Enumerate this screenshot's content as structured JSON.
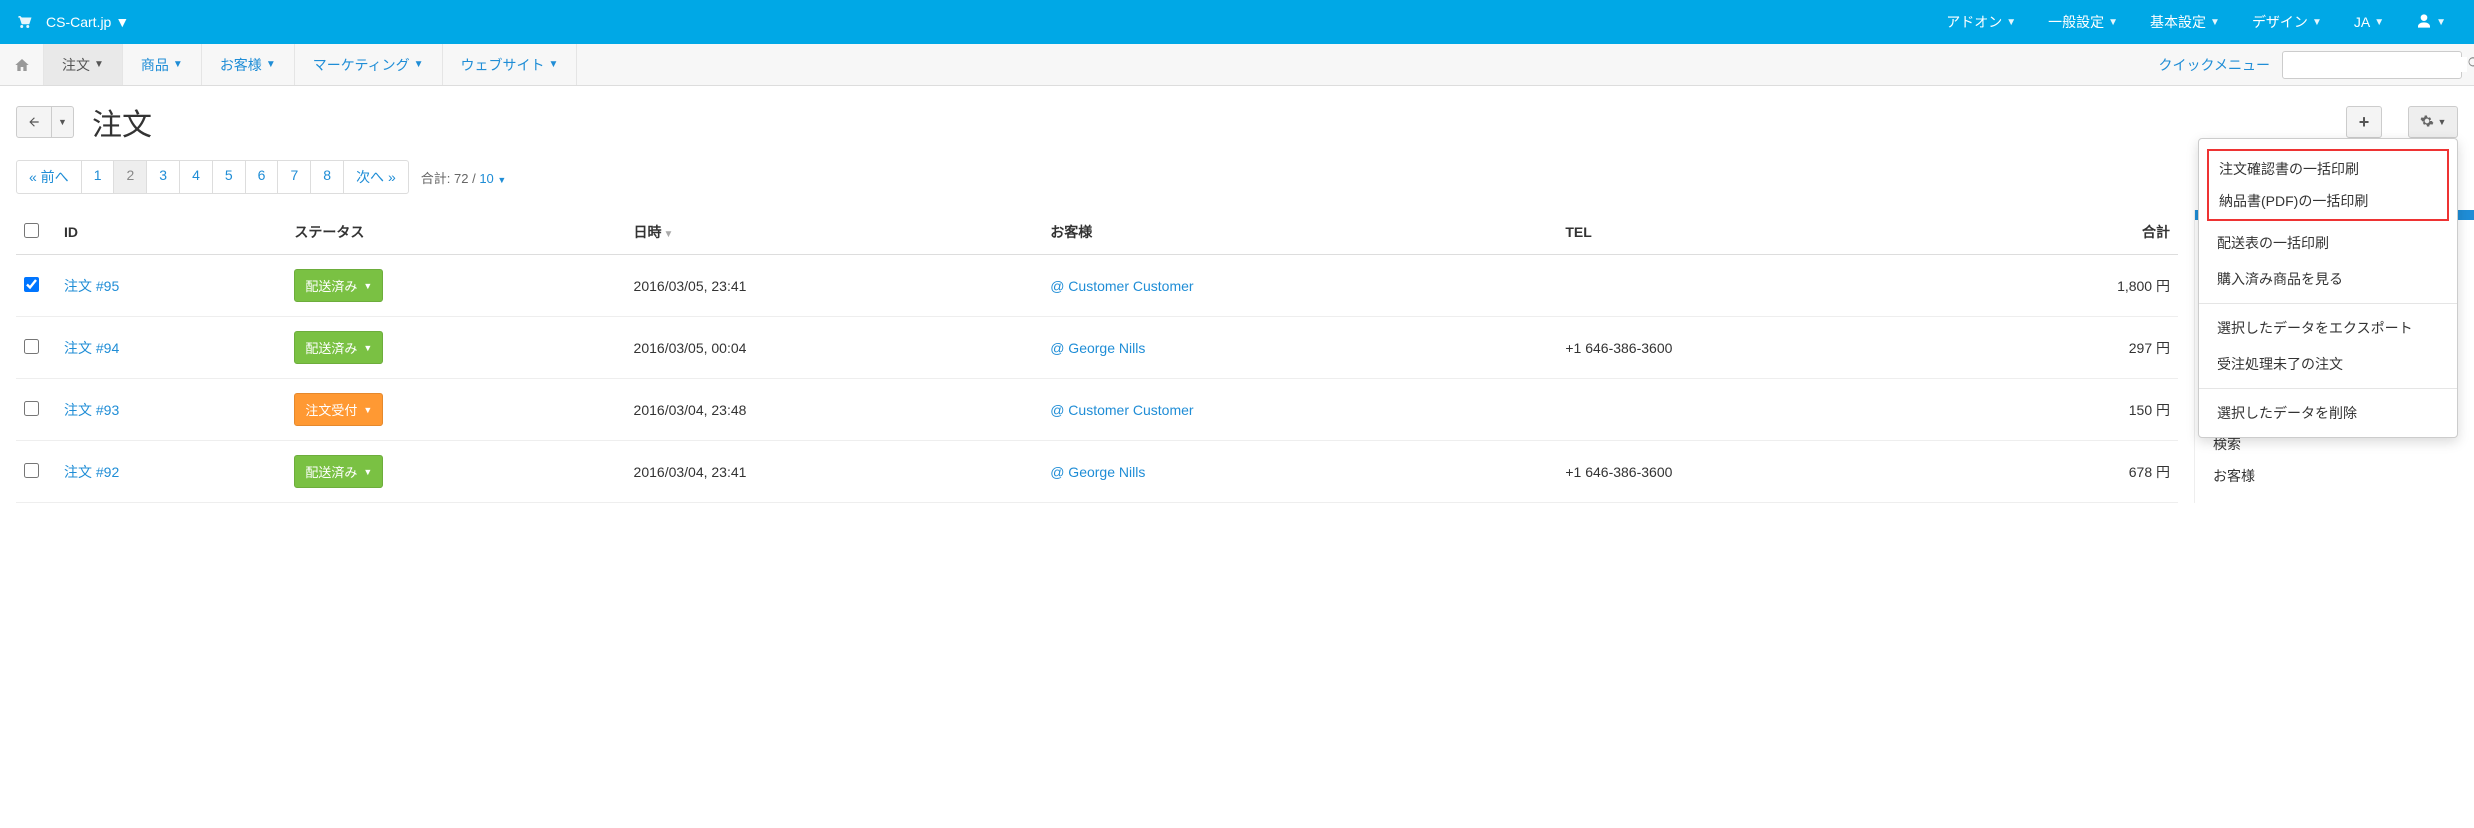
{
  "topbar": {
    "brand": "CS-Cart.jp",
    "menu": [
      "アドオン",
      "一般設定",
      "基本設定",
      "デザイン",
      "JA"
    ]
  },
  "navbar": {
    "items": [
      {
        "label": "注文",
        "active": true
      },
      {
        "label": "商品",
        "active": false
      },
      {
        "label": "お客様",
        "active": false
      },
      {
        "label": "マーケティング",
        "active": false
      },
      {
        "label": "ウェブサイト",
        "active": false
      }
    ],
    "quick": "クイックメニュー",
    "search_placeholder": ""
  },
  "page": {
    "title": "注文"
  },
  "pagination": {
    "prev": "« 前へ",
    "pages": [
      "1",
      "2",
      "3",
      "4",
      "5",
      "6",
      "7",
      "8"
    ],
    "active": "2",
    "next": "次へ »",
    "total_label": "合計:",
    "total_count": "72",
    "per_page": "10"
  },
  "columns": {
    "id": "ID",
    "status": "ステータス",
    "datetime": "日時",
    "customer": "お客様",
    "tel": "TEL",
    "total": "合計"
  },
  "rows": [
    {
      "checked": true,
      "id": "注文 #95",
      "status": "配送済み",
      "status_color": "green",
      "datetime": "2016/03/05, 23:41",
      "customer": "Customer Customer",
      "tel": "",
      "total": "1,800 円"
    },
    {
      "checked": false,
      "id": "注文 #94",
      "status": "配送済み",
      "status_color": "green",
      "datetime": "2016/03/05, 00:04",
      "customer": "George Nills",
      "tel": "+1 646-386-3600",
      "total": "297 円"
    },
    {
      "checked": false,
      "id": "注文 #93",
      "status": "注文受付",
      "status_color": "orange",
      "datetime": "2016/03/04, 23:48",
      "customer": "Customer Customer",
      "tel": "",
      "total": "150 円"
    },
    {
      "checked": false,
      "id": "注文 #92",
      "status": "配送済み",
      "status_color": "green",
      "datetime": "2016/03/04, 23:41",
      "customer": "George Nills",
      "tel": "+1 646-386-3600",
      "total": "678 円"
    }
  ],
  "gear_menu": {
    "highlighted": [
      "注文確認書の一括印刷",
      "納品書(PDF)の一括印刷"
    ],
    "group1": [
      "配送表の一括印刷",
      "購入済み商品を見る"
    ],
    "group2": [
      "選択したデータをエクスポート",
      "受注処理未了の注文"
    ],
    "group3": [
      "選択したデータを削除"
    ]
  },
  "side": {
    "search": "検索",
    "customer": "お客様"
  }
}
